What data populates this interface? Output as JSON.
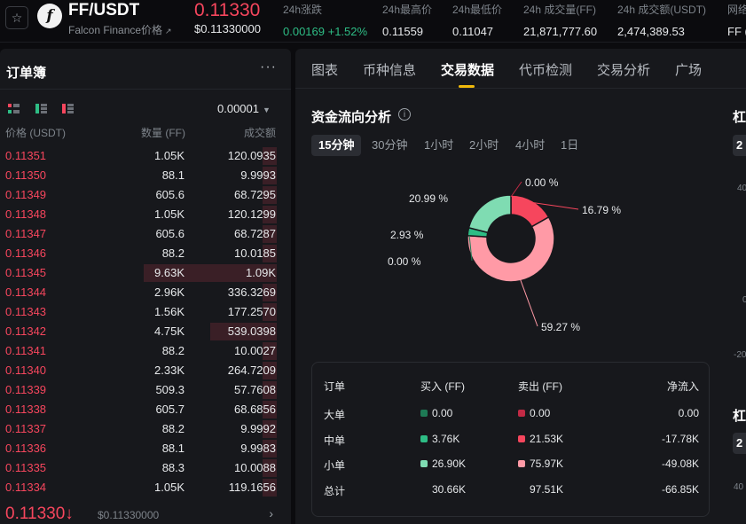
{
  "header": {
    "pair": "FF/USDT",
    "subtitle": "Falcon Finance价格",
    "subtitle_arrow": "↗",
    "logo_letter": "f",
    "last_price": "0.11330",
    "last_price_usd": "$0.11330000",
    "stats": [
      {
        "label": "24h涨跌",
        "value": "0.00169 +1.52%",
        "tone": "green"
      },
      {
        "label": "24h最高价",
        "value": "0.11559",
        "tone": "white"
      },
      {
        "label": "24h最低价",
        "value": "0.11047",
        "tone": "white"
      },
      {
        "label": "24h 成交量(FF)",
        "value": "21,871,777.60",
        "tone": "white"
      },
      {
        "label": "24h 成交额(USDT)",
        "value": "2,474,389.53",
        "tone": "white"
      },
      {
        "label": "网络",
        "value": "FF (",
        "tone": "white"
      }
    ]
  },
  "orderbook": {
    "title": "订单簿",
    "more": "···",
    "precision": "0.00001",
    "columns": {
      "price": "价格 (USDT)",
      "qty": "数量 (FF)",
      "total": "成交额"
    },
    "rows": [
      {
        "price": "0.11351",
        "qty": "1.05K",
        "total": "120.0935",
        "depth": 0.05
      },
      {
        "price": "0.11350",
        "qty": "88.1",
        "total": "9.9993",
        "depth": 0.05
      },
      {
        "price": "0.11349",
        "qty": "605.6",
        "total": "68.7295",
        "depth": 0.05
      },
      {
        "price": "0.11348",
        "qty": "1.05K",
        "total": "120.1299",
        "depth": 0.05
      },
      {
        "price": "0.11347",
        "qty": "605.6",
        "total": "68.7287",
        "depth": 0.05
      },
      {
        "price": "0.11346",
        "qty": "88.2",
        "total": "10.0185",
        "depth": 0.05
      },
      {
        "price": "0.11345",
        "qty": "9.63K",
        "total": "1.09K",
        "depth": 0.48
      },
      {
        "price": "0.11344",
        "qty": "2.96K",
        "total": "336.3269",
        "depth": 0.05
      },
      {
        "price": "0.11343",
        "qty": "1.56K",
        "total": "177.2570",
        "depth": 0.05
      },
      {
        "price": "0.11342",
        "qty": "4.75K",
        "total": "539.0398",
        "depth": 0.24
      },
      {
        "price": "0.11341",
        "qty": "88.2",
        "total": "10.0027",
        "depth": 0.05
      },
      {
        "price": "0.11340",
        "qty": "2.33K",
        "total": "264.7209",
        "depth": 0.05
      },
      {
        "price": "0.11339",
        "qty": "509.3",
        "total": "57.7608",
        "depth": 0.05
      },
      {
        "price": "0.11338",
        "qty": "605.7",
        "total": "68.6856",
        "depth": 0.05
      },
      {
        "price": "0.11337",
        "qty": "88.2",
        "total": "9.9992",
        "depth": 0.05
      },
      {
        "price": "0.11336",
        "qty": "88.1",
        "total": "9.9983",
        "depth": 0.05
      },
      {
        "price": "0.11335",
        "qty": "88.3",
        "total": "10.0088",
        "depth": 0.05
      },
      {
        "price": "0.11334",
        "qty": "1.05K",
        "total": "119.1656",
        "depth": 0.05
      }
    ],
    "footer": {
      "price": "0.11330",
      "arrow": "↓",
      "usd": "$0.11330000",
      "chevron": "›"
    }
  },
  "tabs": [
    "图表",
    "币种信息",
    "交易数据",
    "代币检测",
    "交易分析",
    "广场"
  ],
  "active_tab": 2,
  "fund_flow": {
    "title": "资金流向分析",
    "info_icon": "i",
    "periods": [
      "15分钟",
      "30分钟",
      "1小时",
      "2小时",
      "4小时",
      "1日"
    ],
    "active_period": 0,
    "colors": {
      "buy_large": "#1e7a55",
      "buy_mid": "#2ebd85",
      "buy_small": "#7fdcb2",
      "sell_large": "#c22a45",
      "sell_mid": "#f6465d",
      "sell_small": "#ff9aa6"
    },
    "donut": [
      {
        "key": "sell_large",
        "pct": "0.00 %",
        "value": 0.0
      },
      {
        "key": "sell_mid",
        "pct": "16.79 %",
        "value": 16.79
      },
      {
        "key": "sell_small",
        "pct": "59.27 %",
        "value": 59.27
      },
      {
        "key": "buy_large",
        "pct": "0.00 %",
        "value": 0.0
      },
      {
        "key": "buy_mid",
        "pct": "2.93 %",
        "value": 2.93
      },
      {
        "key": "buy_small",
        "pct": "20.99 %",
        "value": 20.99
      }
    ],
    "table": {
      "headers": [
        "订单",
        "买入 (FF)",
        "卖出 (FF)",
        "净流入"
      ],
      "rows": [
        {
          "name": "大单",
          "buy": "0.00",
          "sell": "0.00",
          "net": "0.00",
          "buy_color": "#1e7a55",
          "sell_color": "#c22a45"
        },
        {
          "name": "中单",
          "buy": "3.76K",
          "sell": "21.53K",
          "net": "-17.78K",
          "buy_color": "#2ebd85",
          "sell_color": "#f6465d"
        },
        {
          "name": "小单",
          "buy": "26.90K",
          "sell": "75.97K",
          "net": "-49.08K",
          "buy_color": "#7fdcb2",
          "sell_color": "#ff9aa6"
        },
        {
          "name": "总计",
          "buy": "30.66K",
          "sell": "97.51K",
          "net": "-66.85K"
        }
      ]
    }
  },
  "clipped_right": {
    "title1": "杠",
    "box1": "2",
    "nums": [
      "40",
      "0",
      "-20"
    ],
    "title2": "杠",
    "box2": "2",
    "num_bottom": "40"
  }
}
